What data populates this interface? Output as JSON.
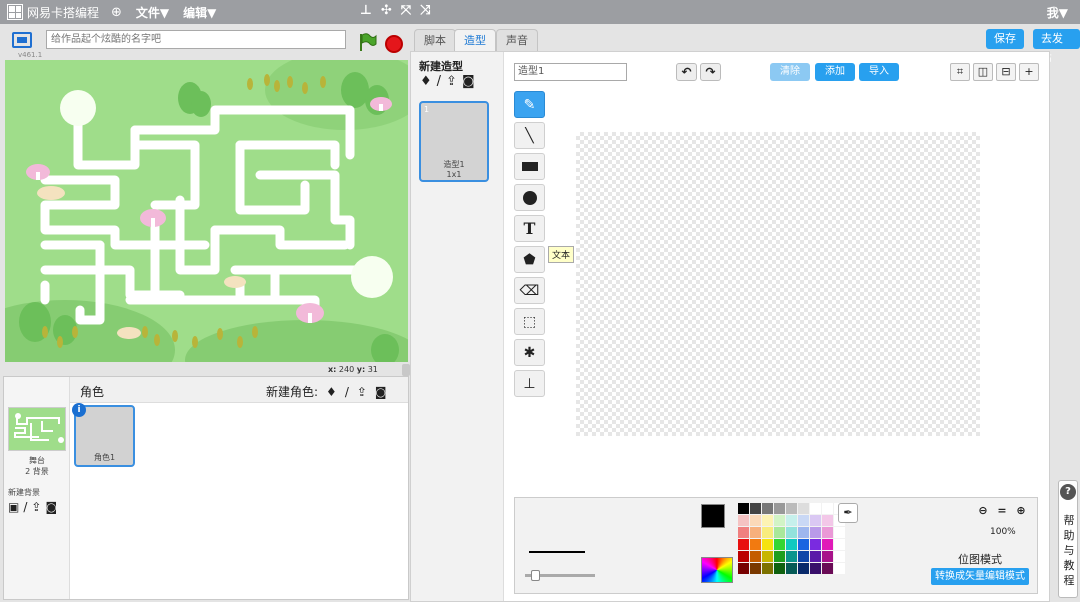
{
  "menubar": {
    "app_name": "网易卡搭编程",
    "menu_file": "文件▼",
    "menu_edit": "编辑▼",
    "tool_icons": [
      "stamp-icon",
      "move-icon",
      "grow-icon",
      "shrink-icon"
    ],
    "user_menu": "我▼"
  },
  "stage_header": {
    "version": "v461.1",
    "title_placeholder": "给作品起个炫酷的名字吧"
  },
  "stage": {
    "x_label": "x:",
    "x_value": "240",
    "y_label": "y:",
    "y_value": "31"
  },
  "sprites": {
    "title": "角色",
    "new_sprite_label": "新建角色:",
    "stage_label": "舞台",
    "stage_backdrop_count": "2 背景",
    "new_backdrop_label": "新建背景",
    "items": [
      {
        "name": "角色1"
      }
    ]
  },
  "editor": {
    "tabs": [
      "脚本",
      "造型",
      "声音"
    ],
    "active_tab": "造型",
    "save_btn": "保存",
    "publish_btn": "去发布",
    "new_costume_label": "新建造型",
    "costume": {
      "number": "1",
      "name": "造型1",
      "size": "1x1"
    },
    "costume_name_value": "造型1",
    "clear_btn": "清除",
    "add_btn": "添加",
    "import_btn": "导入",
    "tooltip_text": "文本",
    "zoom": "100%",
    "mode_label": "位图模式",
    "convert_btn": "转换成矢量编辑模式"
  },
  "help": {
    "label": "帮助与教程",
    "chars": [
      "帮",
      "助",
      "与",
      "教",
      "程"
    ],
    "icon": "?"
  },
  "colors": {
    "accent": "#28a0ef",
    "menubar": "#9c9ea2",
    "stage_grass": "#9fdd8a"
  }
}
